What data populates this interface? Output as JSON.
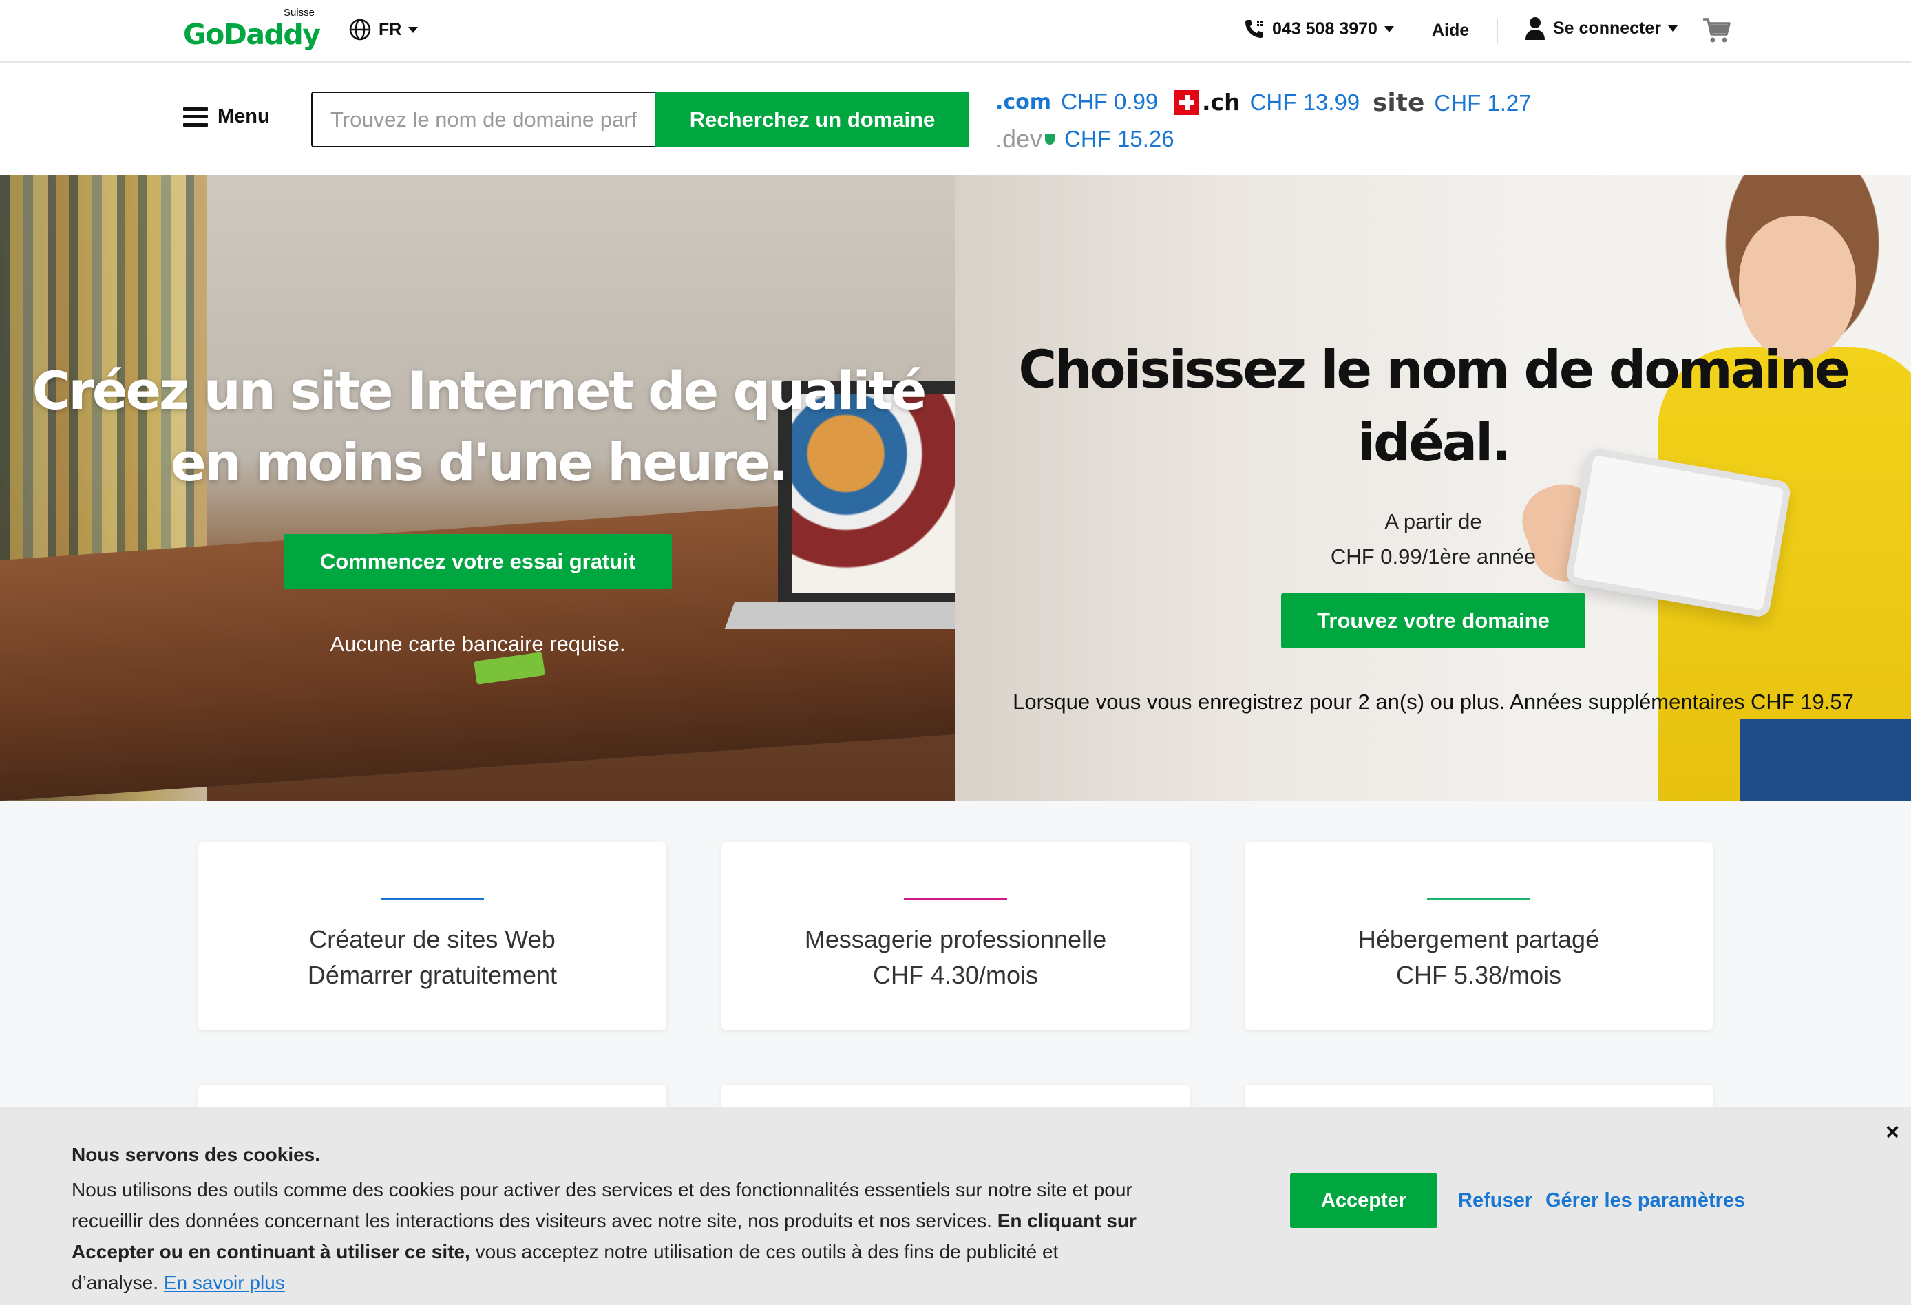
{
  "header": {
    "logo_text": "GoDaddy",
    "logo_country": "Suisse",
    "language": "FR",
    "phone": "043 508 3970",
    "help": "Aide",
    "signin": "Se connecter"
  },
  "search": {
    "menu_label": "Menu",
    "placeholder": "Trouvez le nom de domaine parfait",
    "button": "Recherchez un domaine",
    "tlds": [
      {
        "name": ".com",
        "price": "CHF 0.99"
      },
      {
        "name": ".ch",
        "price": "CHF 13.99"
      },
      {
        "name": "site",
        "price": "CHF 1.27"
      },
      {
        "name": ".dev",
        "price": "CHF 15.26"
      }
    ]
  },
  "hero_left": {
    "title": "Créez un site Internet de qualité en moins d'une heure.",
    "cta": "Commencez votre essai gratuit",
    "note": "Aucune carte bancaire requise."
  },
  "hero_right": {
    "title": "Choisissez le nom de domaine idéal.",
    "from": "A partir de",
    "price": "CHF 0.99/1ère année",
    "cta": "Trouvez votre domaine",
    "note": "Lorsque vous vous enregistrez pour 2 an(s) ou plus. Années supplémentaires CHF 19.57"
  },
  "cards": [
    {
      "line1": "Créateur de sites Web",
      "line2": "Démarrer gratuitement",
      "accent": "#1976d2"
    },
    {
      "line1": "Messagerie professionnelle",
      "line2": "CHF 4.30/mois",
      "accent": "#d1188f"
    },
    {
      "line1": "Hébergement partagé",
      "line2": "CHF 5.38/mois",
      "accent": "#1bb26b"
    }
  ],
  "cookie": {
    "title": "Nous servons des cookies.",
    "text_1": "Nous utilisons des outils comme des cookies pour activer des services et des fonctionnalités essentiels sur notre site et pour recueillir des données concernant les interactions des visiteurs avec notre site, nos produits et nos services.",
    "text_bold": "En cliquant sur Accepter ou en continuant à utiliser ce site,",
    "text_2": " vous acceptez notre utilisation de ces outils à des fins de publicité et d’analyse. ",
    "learn_more": "En savoir plus",
    "accept": "Accepter",
    "refuse": "Refuser",
    "manage": "Gérer les paramètres",
    "close": "×"
  },
  "colors": {
    "brand_green": "#00a63f",
    "link_blue": "#1976d2"
  }
}
